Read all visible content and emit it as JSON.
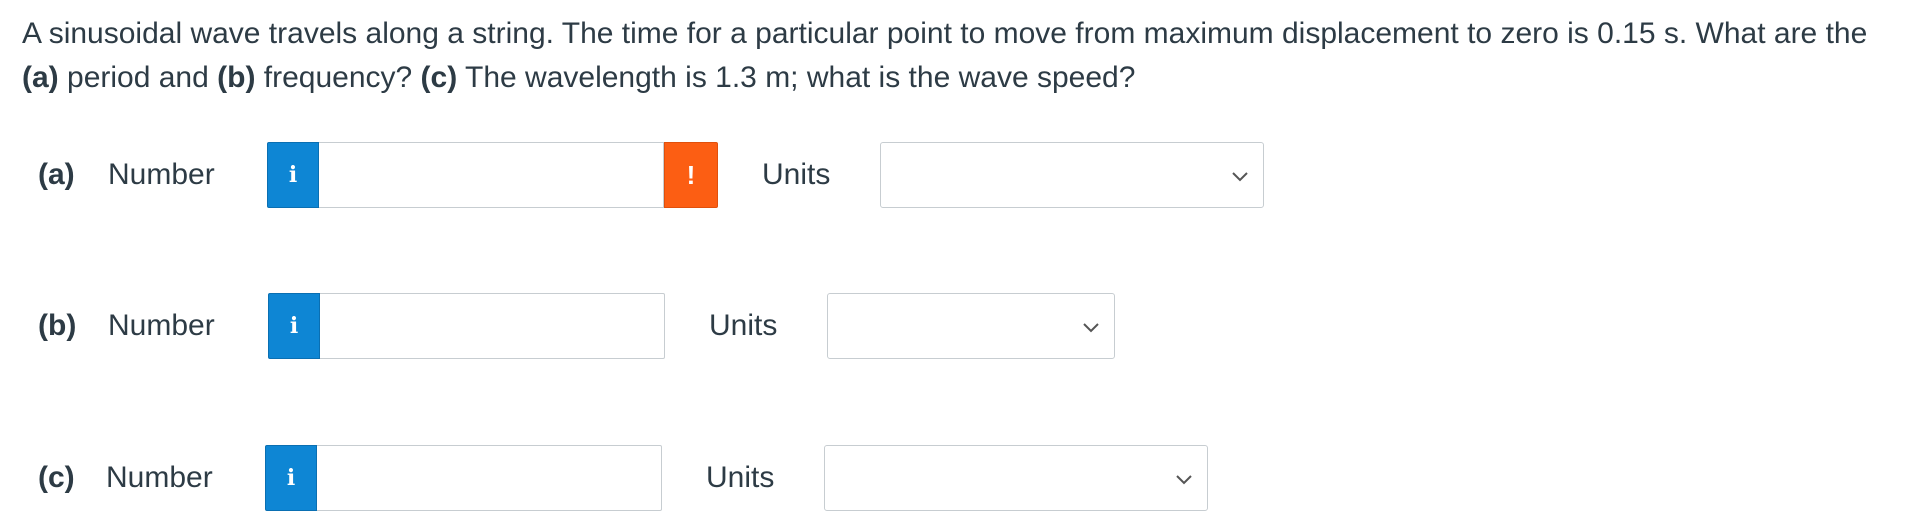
{
  "question": {
    "t1": "A sinusoidal wave travels along a string. The time for a particular point to move from maximum displacement to zero is 0.15 s. What are the ",
    "a": "(a)",
    "t2": " period and ",
    "b": "(b)",
    "t3": " frequency? ",
    "c": "(c)",
    "t4": " The wavelength is 1.3 m; what is the wave speed?"
  },
  "parts": [
    {
      "label": "(a)",
      "number_label": "Number",
      "info_icon": "i",
      "value": "",
      "warning_icon": "!",
      "units_label": "Units",
      "units_value": ""
    },
    {
      "label": "(b)",
      "number_label": "Number",
      "info_icon": "i",
      "value": "",
      "units_label": "Units",
      "units_value": ""
    },
    {
      "label": "(c)",
      "number_label": "Number",
      "info_icon": "i",
      "value": "",
      "units_label": "Units",
      "units_value": ""
    }
  ],
  "icons": {
    "info": "info-icon",
    "warning": "warning-icon",
    "chevron": "chevron-down-icon"
  },
  "colors": {
    "info": "#0e86d4",
    "warning": "#fc5e13",
    "text": "#2d3b45",
    "border": "#c7cdd1"
  }
}
